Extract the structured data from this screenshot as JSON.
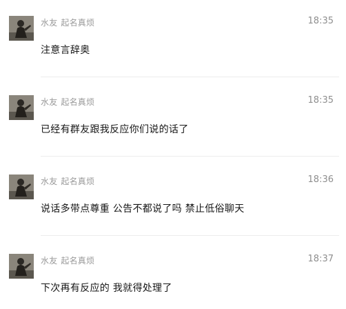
{
  "messages": [
    {
      "sender": "水友",
      "nickname": "起名真烦",
      "time": "18:35",
      "text": "注意言辞奥"
    },
    {
      "sender": "水友",
      "nickname": "起名真烦",
      "time": "18:35",
      "text": "已经有群友跟我反应你们说的话了"
    },
    {
      "sender": "水友",
      "nickname": "起名真烦",
      "time": "18:36",
      "text": "说话多带点尊重 公告不都说了吗 禁止低俗聊天"
    },
    {
      "sender": "水友",
      "nickname": "起名真烦",
      "time": "18:37",
      "text": "下次再有反应的 我就得处理了"
    }
  ]
}
